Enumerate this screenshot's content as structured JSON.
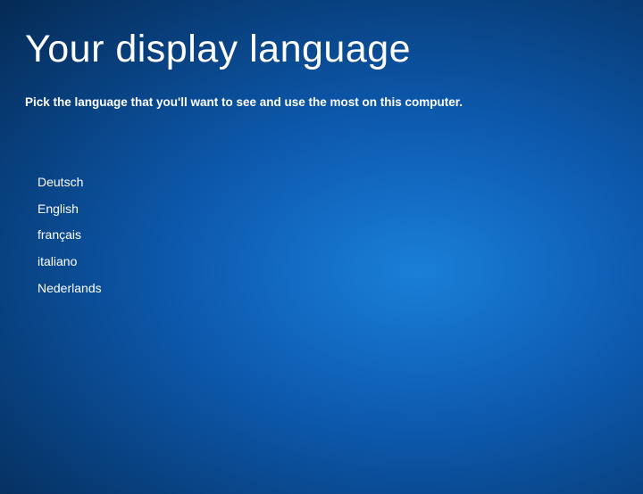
{
  "header": {
    "title": "Your display language",
    "subtitle": "Pick the language that you'll want to see and use the most on this computer."
  },
  "languages": [
    {
      "label": "Deutsch"
    },
    {
      "label": "English"
    },
    {
      "label": "français"
    },
    {
      "label": "italiano"
    },
    {
      "label": "Nederlands"
    }
  ]
}
